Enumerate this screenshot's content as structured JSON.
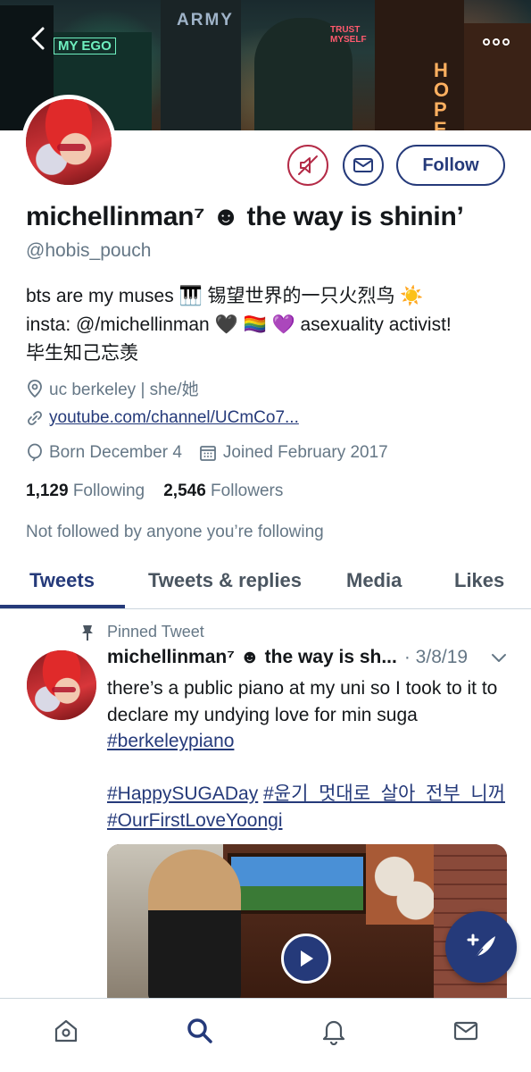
{
  "header": {
    "back_icon": "chevron-left-icon",
    "more_icon": "more-horizontal-icon",
    "banner_signs": [
      "ARMY",
      "MY EGO",
      "TRUST MYSELF",
      "HOPE"
    ]
  },
  "profile": {
    "display_name": "michellinman⁷ ☻ the way is shinin’",
    "handle": "@hobis_pouch",
    "bio_line1": "bts are my muses 🎹 锡望世界的一只火烈鸟 ☀️",
    "bio_line2": "insta: @/michellinman 🖤 🏳️‍🌈 💜  asexuality activist!",
    "bio_line3": "毕生知己忘羡",
    "location": "uc berkeley | she/她",
    "url": "youtube.com/channel/UCmCo7...",
    "birthday": "Born December 4",
    "joined": "Joined February 2017",
    "following_count": "1,129",
    "following_label": "Following",
    "followers_count": "2,546",
    "followers_label": "Followers",
    "followed_by": "Not followed by anyone you’re following",
    "follow_label": "Follow"
  },
  "tabs": [
    {
      "label": "Tweets",
      "active": true
    },
    {
      "label": "Tweets & replies",
      "active": false
    },
    {
      "label": "Media",
      "active": false
    },
    {
      "label": "Likes",
      "active": false
    }
  ],
  "pinned_tweet": {
    "pinned_label": "Pinned Tweet",
    "author": "michellinman⁷ ☻ the way is sh...",
    "date": "· 3/8/19",
    "text": "there’s a public piano at my uni so I took to it to declare my undying love for min suga",
    "hashtag1": "#berkeleypiano",
    "hashtag2": "#HappySUGADay",
    "hashtag3": "#윤기_멋대로_살아_전부_니꺼",
    "hashtag4": "#OurFirstLoveYoongi"
  },
  "colors": {
    "accent": "#253a7a",
    "mute": "#b42b47",
    "secondary_text": "#657786"
  },
  "bottom_nav": [
    "home-icon",
    "search-icon",
    "notifications-icon",
    "messages-icon"
  ]
}
